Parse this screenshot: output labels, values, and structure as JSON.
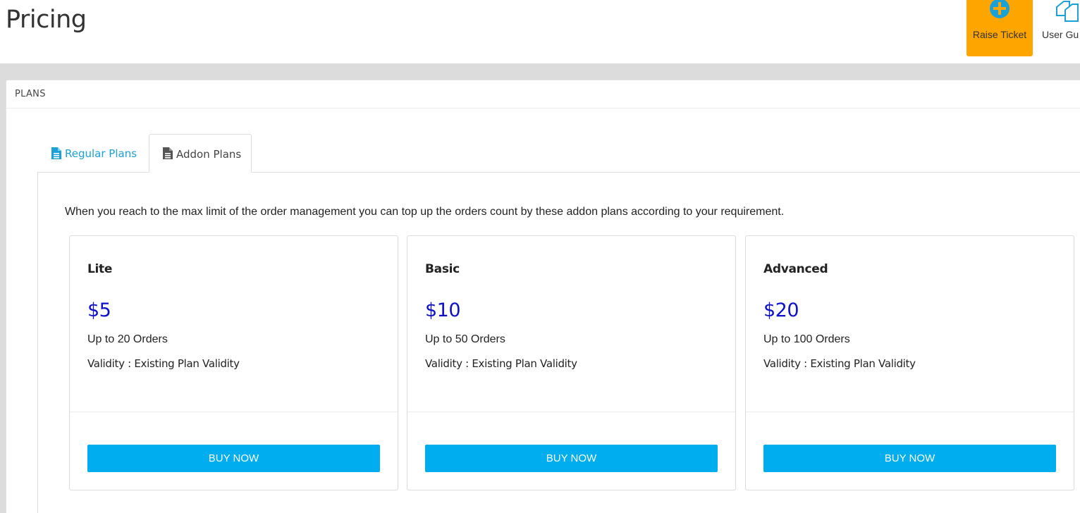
{
  "page": {
    "title": "Pricing"
  },
  "header_actions": {
    "raise_ticket": {
      "label": "Raise Ticket",
      "icon": "plus-circle-icon"
    },
    "user_guide": {
      "label": "User Gu",
      "icon": "copy-documents-icon"
    }
  },
  "panel": {
    "heading": "PLANS"
  },
  "tabs": [
    {
      "label": "Regular Plans",
      "icon": "document-icon",
      "active": false
    },
    {
      "label": "Addon Plans",
      "icon": "document-icon",
      "active": true
    }
  ],
  "addon": {
    "intro": "When you reach to the max limit of the order management you can top up the orders count by these addon plans according to your requirement.",
    "plans": [
      {
        "name": "Lite",
        "price": "$5",
        "orders": "Up to 20 Orders",
        "validity": "Validity : Existing Plan Validity",
        "button": "BUY NOW"
      },
      {
        "name": "Basic",
        "price": "$10",
        "orders": "Up to 50 Orders",
        "validity": "Validity : Existing Plan Validity",
        "button": "BUY NOW"
      },
      {
        "name": "Advanced",
        "price": "$20",
        "orders": "Up to 100 Orders",
        "validity": "Validity : Existing Plan Validity",
        "button": "BUY NOW"
      }
    ]
  },
  "colors": {
    "accent_orange": "#ffa500",
    "accent_blue": "#00aeef",
    "tab_link": "#1ba0d8",
    "price": "#1010c8",
    "background_gray": "#dcdcdc"
  }
}
